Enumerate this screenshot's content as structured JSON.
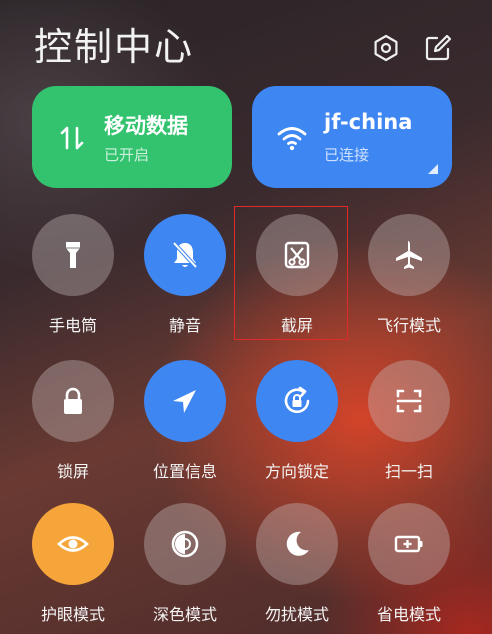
{
  "header": {
    "title": "控制中心",
    "settings_icon": "settings-icon",
    "edit_icon": "edit-icon"
  },
  "big_tiles": [
    {
      "title": "移动数据",
      "status": "已开启",
      "icon": "data-transfer-icon",
      "color": "#33c36f"
    },
    {
      "title": "jf-china",
      "status": "已连接",
      "icon": "wifi-icon",
      "color": "#3e86f2"
    }
  ],
  "toggles": [
    {
      "label": "手电筒",
      "icon": "flashlight-icon",
      "state": "off"
    },
    {
      "label": "静音",
      "icon": "bell-off-icon",
      "state": "on"
    },
    {
      "label": "截屏",
      "icon": "screenshot-icon",
      "state": "off"
    },
    {
      "label": "飞行模式",
      "icon": "airplane-icon",
      "state": "off"
    },
    {
      "label": "锁屏",
      "icon": "lock-icon",
      "state": "off"
    },
    {
      "label": "位置信息",
      "icon": "location-icon",
      "state": "on"
    },
    {
      "label": "方向锁定",
      "icon": "rotation-lock-icon",
      "state": "on"
    },
    {
      "label": "扫一扫",
      "icon": "scan-icon",
      "state": "off"
    },
    {
      "label": "护眼模式",
      "icon": "eye-icon",
      "state": "on"
    },
    {
      "label": "深色模式",
      "icon": "dark-mode-icon",
      "state": "off"
    },
    {
      "label": "勿扰模式",
      "icon": "moon-icon",
      "state": "off"
    },
    {
      "label": "省电模式",
      "icon": "battery-saver-icon",
      "state": "off"
    }
  ],
  "colors": {
    "accent_blue": "#3e86f2",
    "accent_green": "#33c36f",
    "accent_orange": "#f5a53a",
    "highlight_red": "#e02a2a"
  }
}
